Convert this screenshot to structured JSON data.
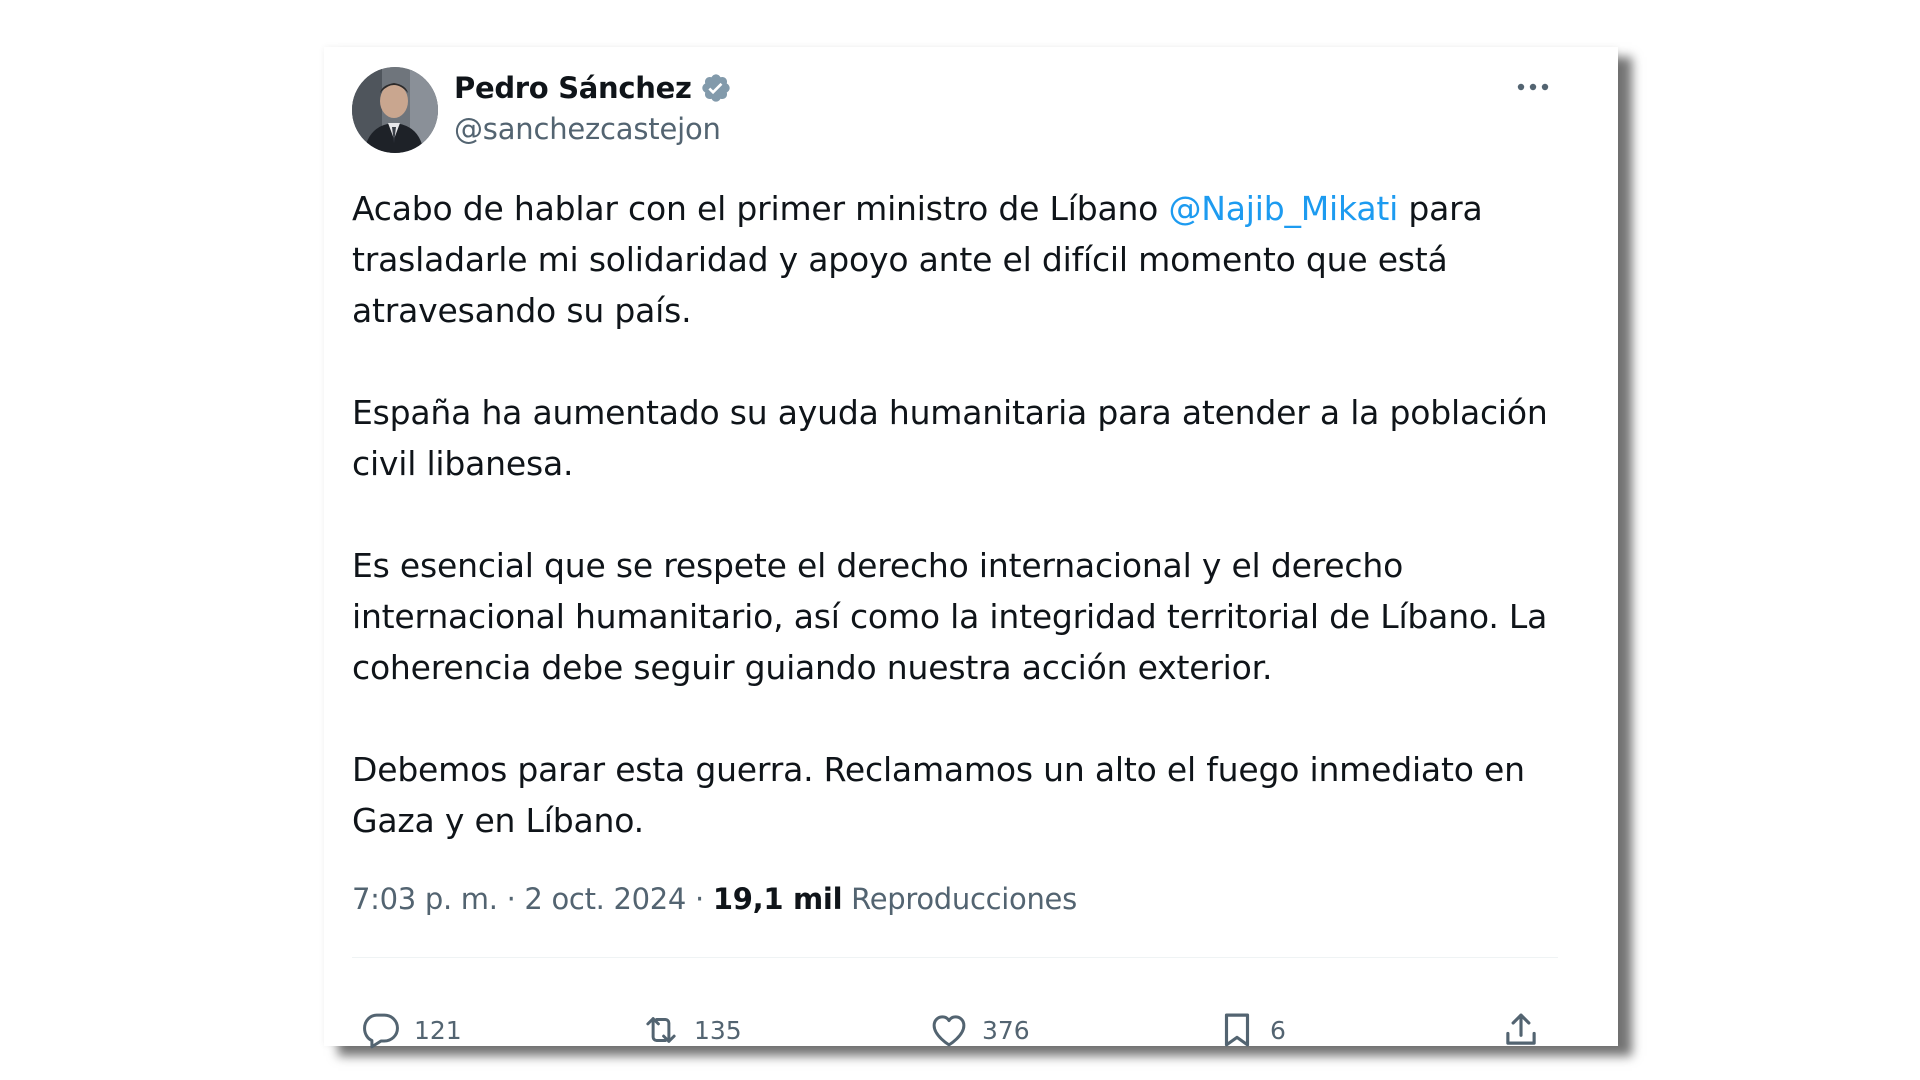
{
  "author": {
    "display_name": "Pedro Sánchez",
    "handle": "@sanchezcastejon",
    "verified": true
  },
  "tweet": {
    "paragraphs": [
      {
        "before": "Acabo de hablar con el primer ministro de Líbano ",
        "mention": "@Najib_Mikati",
        "after": " para trasladarle mi solidaridad y apoyo ante el difícil momento que está atravesando su país."
      },
      {
        "text": "España ha aumentado su ayuda humanitaria para atender a la población civil libanesa."
      },
      {
        "text": "Es esencial que se respete el derecho internacional y el derecho internacional humanitario, así como la integridad territorial de Líbano. La coherencia debe seguir guiando nuestra acción exterior."
      },
      {
        "text": "Debemos parar esta guerra. Reclamamos un alto el fuego inmediato en Gaza y en Líbano."
      }
    ]
  },
  "meta": {
    "time": "7:03 p. m.",
    "separator": "·",
    "date": "2 oct. 2024",
    "views_count": "19,1 mil",
    "views_label": "Reproducciones"
  },
  "actions": {
    "replies": "121",
    "retweets": "135",
    "likes": "376",
    "bookmarks": "6"
  },
  "icons": {
    "verified": "verified-badge-icon",
    "more": "more-icon",
    "reply": "reply-icon",
    "retweet": "retweet-icon",
    "like": "heart-icon",
    "bookmark": "bookmark-icon",
    "share": "share-icon"
  },
  "colors": {
    "text_primary": "#0f1419",
    "text_secondary": "#536471",
    "mention": "#1d9bf0",
    "verified_badge": "#829aab"
  }
}
